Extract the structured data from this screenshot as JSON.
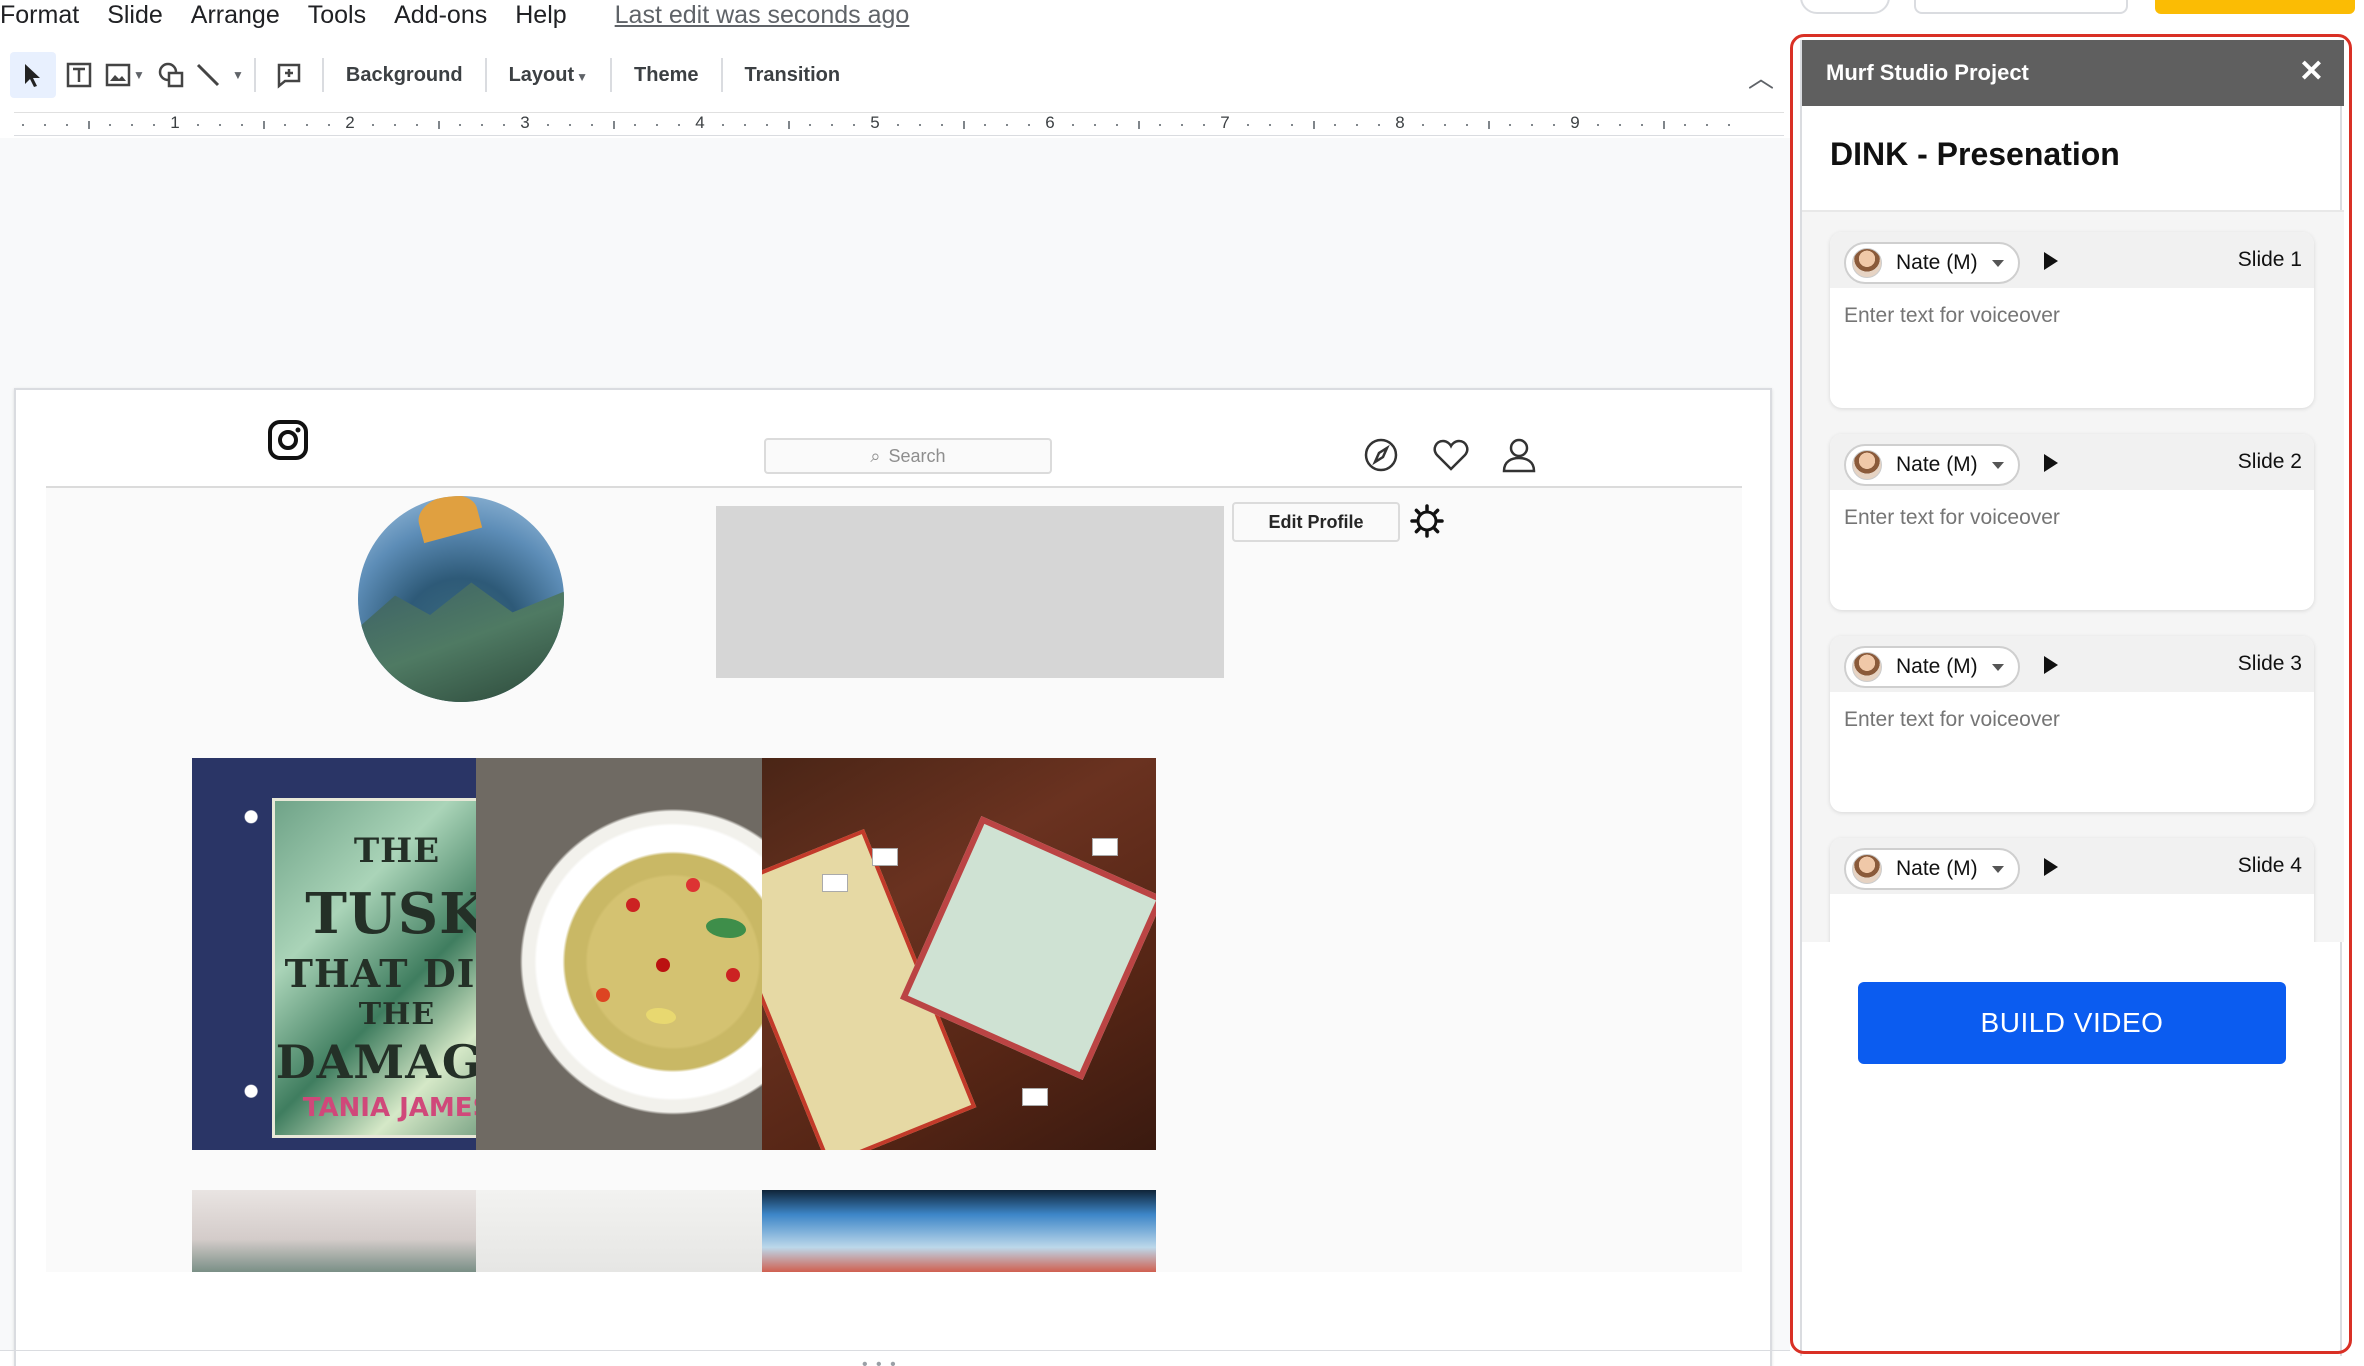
{
  "menu": {
    "items": [
      "Format",
      "Slide",
      "Arrange",
      "Tools",
      "Add-ons",
      "Help"
    ],
    "last_edit": "Last edit was seconds ago"
  },
  "toolbar": {
    "background_label": "Background",
    "layout_label": "Layout",
    "theme_label": "Theme",
    "transition_label": "Transition"
  },
  "ruler": {
    "numbers": [
      "1",
      "2",
      "3",
      "4",
      "5",
      "6",
      "7",
      "8",
      "9"
    ]
  },
  "slide_content": {
    "search_placeholder": "Search",
    "edit_profile_label": "Edit Profile",
    "book": {
      "title_lines": [
        "THE",
        "TUSK",
        "THAT DID",
        "THE",
        "DAMAGE"
      ],
      "author": "TANIA JAMES"
    }
  },
  "panel": {
    "header_title": "Murf Studio Project",
    "close_icon": "✕",
    "project_title": "DINK - Presenation",
    "voiceover_placeholder": "Enter text for voiceover",
    "slides": [
      {
        "voice": "Nate (M)",
        "label": "Slide 1"
      },
      {
        "voice": "Nate (M)",
        "label": "Slide 2"
      },
      {
        "voice": "Nate (M)",
        "label": "Slide 3"
      },
      {
        "voice": "Nate (M)",
        "label": "Slide 4"
      }
    ],
    "build_label": "BUILD VIDEO"
  },
  "colors": {
    "panel_header": "#5f5f5f",
    "build_button": "#0b5cf0",
    "highlight_outline": "#d93025"
  }
}
